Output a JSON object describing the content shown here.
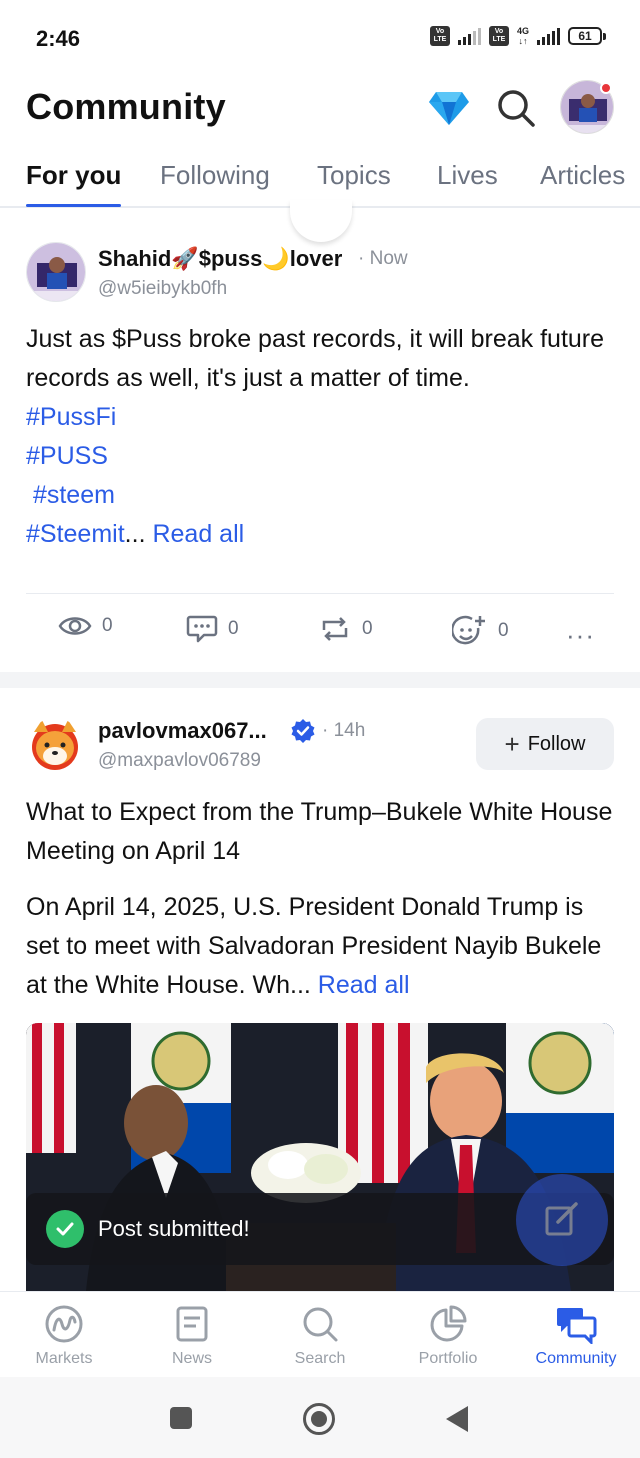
{
  "status_bar": {
    "time": "2:46",
    "volte_label": "Vo LTE",
    "network": "4G",
    "battery": "61"
  },
  "header": {
    "title": "Community",
    "diamond_icon": "diamond-icon",
    "search_icon": "search-icon"
  },
  "tabs": [
    "For you",
    "Following",
    "Topics",
    "Lives",
    "Articles"
  ],
  "active_tab": "For you",
  "posts": [
    {
      "author": "Shahid🚀$puss🌙lover",
      "time": "· Now",
      "handle": "@w5ieibykb0fh",
      "text": "Just as $Puss broke past records, it will break future records as well, it's just a matter of time.",
      "tags": [
        "#PussFi",
        "#PUSS",
        " #steem",
        "#Steemit"
      ],
      "ellipsis": "...",
      "read_all": "Read all",
      "stats": {
        "views": "0",
        "comments": "0",
        "reposts": "0",
        "reactions": "0"
      },
      "more": "···"
    },
    {
      "author": "pavlovmax067...",
      "time": "· 14h",
      "handle": "@maxpavlov06789",
      "follow_label": "Follow",
      "title": "What to Expect from the Trump–Bukele White House Meeting on April 14",
      "body": "On April 14, 2025, U.S. President Donald Trump is set to meet with Salvadoran President Nayib Bukele at the White House. Wh...",
      "read_all": "Read all"
    }
  ],
  "toast": {
    "text": "Post submitted!"
  },
  "bottom_nav": [
    {
      "label": "Markets",
      "icon": "markets-icon"
    },
    {
      "label": "News",
      "icon": "news-icon"
    },
    {
      "label": "Search",
      "icon": "search-icon"
    },
    {
      "label": "Portfolio",
      "icon": "portfolio-icon"
    },
    {
      "label": "Community",
      "icon": "community-icon"
    }
  ],
  "active_nav": "Community",
  "colors": {
    "accent": "#2b5ce6",
    "toast_check": "#2fbf6b",
    "diamond": "#1e9be8"
  }
}
